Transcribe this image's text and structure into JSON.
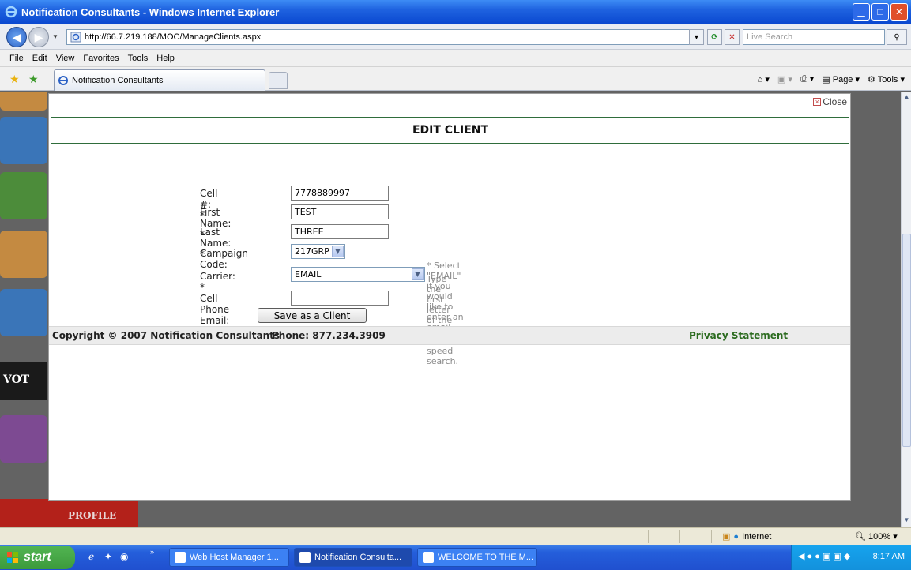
{
  "window": {
    "title": "Notification Consultants - Windows Internet Explorer"
  },
  "addressbar": {
    "url": "http://66.7.219.188/MOC/ManageClients.aspx",
    "search_placeholder": "Live Search"
  },
  "menu": [
    "File",
    "Edit",
    "View",
    "Favorites",
    "Tools",
    "Help"
  ],
  "tab": {
    "label": "Notification Consultants"
  },
  "commandbar": {
    "page": "Page",
    "tools": "Tools"
  },
  "modal": {
    "close_label": "Close",
    "title": "EDIT CLIENT"
  },
  "form": {
    "cell_label": "Cell #: *",
    "cell_value": "7778889997",
    "first_label": "First Name: *",
    "first_value": "TEST",
    "last_label": "Last Name: *",
    "last_value": "THREE",
    "campaign_label": "Campaign Code:",
    "campaign_value": "217GRP",
    "carrier_label": "Carrier: *",
    "carrier_value": "EMAIL",
    "carrier_hint_1": "* Select \"EMAIL\" if you would like to enter an email address.",
    "carrier_hint_2": "Type the first letter of the carrier to speed search.",
    "cellemail_label": "Cell Phone Email: *",
    "cellemail_value": "",
    "save_label": "Save as a Client"
  },
  "footer": {
    "copyright": "Copyright © 2007 Notification Consultants",
    "phone": "Phone: 877.234.3909",
    "privacy": "Privacy Statement"
  },
  "background": {
    "profile_text": "PROFILE",
    "vote_text": "VOT"
  },
  "statusbar": {
    "zone": "Internet",
    "zoom": "100%"
  },
  "taskbar": {
    "start": "start",
    "tasks": [
      "Web Host Manager 1...",
      "Notification Consulta...",
      "WELCOME TO THE M..."
    ],
    "clock": "8:17 AM"
  }
}
